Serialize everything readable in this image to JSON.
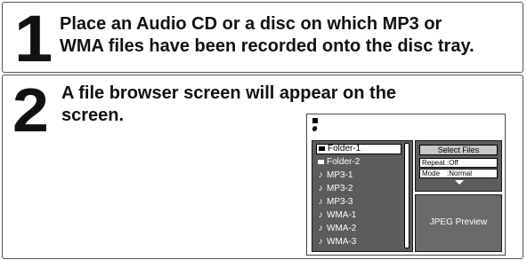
{
  "steps": [
    {
      "number": "1",
      "lines": [
        "Place an Audio CD or a disc on which MP3 or",
        "WMA files have been recorded onto the disc tray."
      ]
    },
    {
      "number": "2",
      "lines": [
        "A file browser screen will appear on the",
        "screen."
      ]
    }
  ],
  "screen": {
    "items": [
      {
        "type": "folder",
        "label": "Folder-1",
        "selected": true
      },
      {
        "type": "folder",
        "label": "Folder-2",
        "selected": false
      },
      {
        "type": "music",
        "label": "MP3-1",
        "selected": false
      },
      {
        "type": "music",
        "label": "MP3-2",
        "selected": false
      },
      {
        "type": "music",
        "label": "MP3-3",
        "selected": false
      },
      {
        "type": "music",
        "label": "WMA-1",
        "selected": false
      },
      {
        "type": "music",
        "label": "WMA-2",
        "selected": false
      },
      {
        "type": "music",
        "label": "WMA-3",
        "selected": false
      }
    ],
    "select_files_label": "Select Files",
    "repeat": {
      "label": "Repeat",
      "value": ":Off"
    },
    "mode": {
      "label": "Mode",
      "value": ":Normal"
    },
    "preview_label": "JPEG Preview",
    "music_glyph": "♪"
  }
}
